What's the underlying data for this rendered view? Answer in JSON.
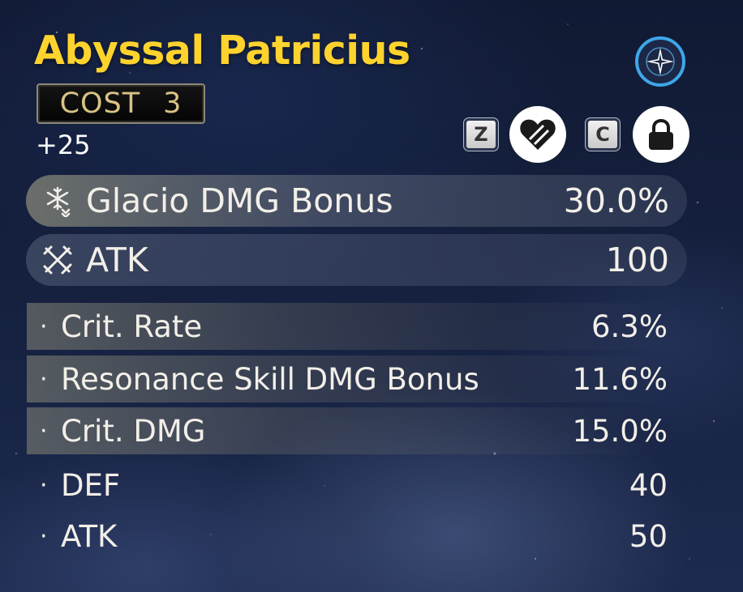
{
  "echo": {
    "name": "Abyssal Patricius",
    "cost_label": "COST",
    "cost_value": "3",
    "level": "+25"
  },
  "controls": {
    "rarity_icon": "compass-star-icon",
    "discard_key": "Z",
    "discard_icon": "broken-heart-icon",
    "lock_key": "C",
    "lock_icon": "padlock-icon"
  },
  "main_stats": [
    {
      "icon": "glacio-snowflake-icon",
      "name": "Glacio DMG Bonus",
      "value": "30.0%"
    },
    {
      "icon": "atk-crossed-swords-icon",
      "name": "ATK",
      "value": "100"
    }
  ],
  "sub_stats": [
    {
      "bullet": "·",
      "name": "Crit. Rate",
      "value": "6.3%"
    },
    {
      "bullet": "·",
      "name": "Resonance Skill DMG Bonus",
      "value": "11.6%"
    },
    {
      "bullet": "·",
      "name": "Crit. DMG",
      "value": "15.0%"
    },
    {
      "bullet": "·",
      "name": "DEF",
      "value": "40"
    },
    {
      "bullet": "·",
      "name": "ATK",
      "value": "50"
    }
  ],
  "colors": {
    "title": "#ffd32e",
    "cost_text": "#d8c384",
    "rarity_ring": "#3fa6ea",
    "stat_text": "#f2efe8"
  }
}
